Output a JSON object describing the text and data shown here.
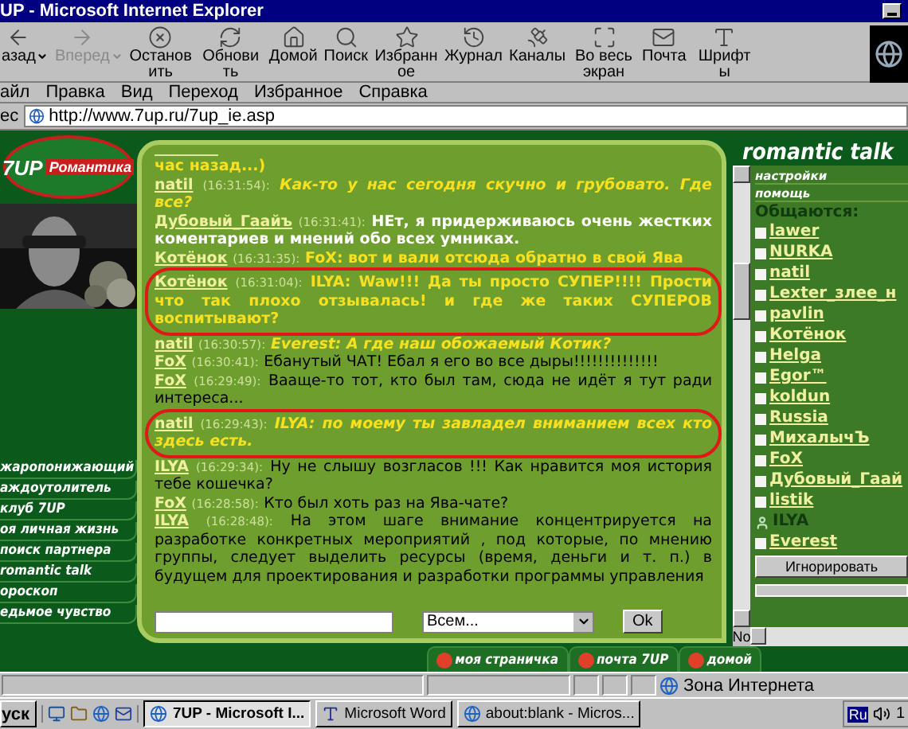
{
  "window": {
    "title": "UP - Microsoft Internet Explorer"
  },
  "toolbar": [
    {
      "label": "азад",
      "disabled": false,
      "dropdown": true
    },
    {
      "label": "Вперед",
      "disabled": true,
      "dropdown": true
    },
    {
      "label": "Остановить",
      "disabled": false,
      "dropdown": false
    },
    {
      "label": "Обновить",
      "disabled": false,
      "dropdown": false
    },
    {
      "label": "Домой",
      "disabled": false,
      "dropdown": false
    },
    {
      "label": "Поиск",
      "disabled": false,
      "dropdown": false
    },
    {
      "label": "Избранное",
      "disabled": false,
      "dropdown": false
    },
    {
      "label": "Журнал",
      "disabled": false,
      "dropdown": false
    },
    {
      "label": "Каналы",
      "disabled": false,
      "dropdown": false
    },
    {
      "label": "Во весь экран",
      "disabled": false,
      "dropdown": false
    },
    {
      "label": "Почта",
      "disabled": false,
      "dropdown": false
    },
    {
      "label": "Шрифты",
      "disabled": false,
      "dropdown": false
    }
  ],
  "menu": [
    "айл",
    "Правка",
    "Вид",
    "Переход",
    "Избранное",
    "Справка"
  ],
  "address": {
    "label": "ес",
    "value": "http://www.7up.ru/7up_ie.asp"
  },
  "logo": {
    "brand": "7UP",
    "tagline": "Романтика"
  },
  "nav": [
    "жаропонижающий",
    "аждоутолитель",
    "клуб 7UP",
    "оя личная жизнь",
    "поиск партнера",
    "romantic talk",
    "ороскоп",
    "едьмое чувство"
  ],
  "chat": [
    {
      "text": "час назад...)",
      "kind": "yellow-bold",
      "circled": false
    },
    {
      "nick": "natil",
      "time": "(16:31:54):",
      "text": "Как-то у нас сегодня скучно и грубовато. Где все?",
      "kind": "yellow-italic",
      "circled": false
    },
    {
      "nick": "Дубовый_Гаайъ",
      "time": "(16:31:41):",
      "text": "НЕт, я придерживаюсь очень жестких коментариев и мнений обо всех умниках.",
      "kind": "white-bold",
      "circled": false
    },
    {
      "nick": "Котёнок",
      "time": "(16:31:35):",
      "text": "FoX: вот и вали отсюда обратно в свой Ява",
      "kind": "yellow-bold",
      "circled": false
    },
    {
      "nick": "Котёнок",
      "time": "(16:31:04):",
      "text": "ILYA: Waw!!! Да ты просто СУПЕР!!!! Прости что так плохо отзывалась! и где же таких СУПЕРОВ воспитывают?",
      "kind": "yellow-bold",
      "circled": true
    },
    {
      "nick": "natil",
      "time": "(16:30:57):",
      "text": "Everest: А где наш обожаемый Котик?",
      "kind": "yellow-italic",
      "circled": false
    },
    {
      "nick": "FoX",
      "time": "(16:30:41):",
      "text": "Ебанутый ЧАТ! Ебал я его во все дыры!!!!!!!!!!!!!!",
      "kind": "plain",
      "circled": false
    },
    {
      "nick": "FoX",
      "time": "(16:29:49):",
      "text": "Вааще-то тот, кто был там, сюда не идёт я тут ради интереса...",
      "kind": "plain",
      "circled": false
    },
    {
      "nick": "natil",
      "time": "(16:29:43):",
      "text": "ILYA: по моему ты завладел вниманием всех кто здесь есть.",
      "kind": "yellow-italic",
      "circled": true
    },
    {
      "nick": "ILYA",
      "time": "(16:29:34):",
      "text": "Ну не слышу возгласов !!! Как нравится моя история тебе кошечка?",
      "kind": "plain",
      "circled": false
    },
    {
      "nick": "FoX",
      "time": "(16:28:58):",
      "text": "Кто был хоть раз на Ява-чате?",
      "kind": "plain",
      "circled": false
    },
    {
      "nick": "ILYA",
      "time": "(16:28:48):",
      "text": "На этом шаге внимание концентрируется на разработке конкретных мероприятий , под которые, по мнению группы, следует выделить ресурсы (время, деньги и т. п.) в будущем для проектирования и разработки программы управления",
      "kind": "plain",
      "circled": false
    }
  ],
  "input": {
    "recipient": "Всем...",
    "ok": "Ok",
    "no": "No"
  },
  "side": {
    "title": "romantic talk",
    "links": [
      "настройки",
      "помощь"
    ],
    "heading": "Общаются:",
    "ignore": "Игнорировать",
    "users": [
      {
        "name": "lawer",
        "kind": "user",
        "checked": false
      },
      {
        "name": "NURKA",
        "kind": "user",
        "checked": false
      },
      {
        "name": "natil",
        "kind": "user",
        "checked": false
      },
      {
        "name": "Lexter_злее_н",
        "kind": "user",
        "checked": false
      },
      {
        "name": "pavlin",
        "kind": "user",
        "checked": false
      },
      {
        "name": "Котёнок",
        "kind": "user",
        "checked": false
      },
      {
        "name": "Helga",
        "kind": "user",
        "checked": false
      },
      {
        "name": "Egor™",
        "kind": "user",
        "checked": false
      },
      {
        "name": "koldun",
        "kind": "user",
        "checked": false
      },
      {
        "name": "Russia",
        "kind": "user",
        "checked": false
      },
      {
        "name": "МихалычЪ",
        "kind": "user",
        "checked": false
      },
      {
        "name": "FoX",
        "kind": "user",
        "checked": false
      },
      {
        "name": "Дубовый_Гаай",
        "kind": "user",
        "checked": false
      },
      {
        "name": "listik",
        "kind": "user",
        "checked": false
      },
      {
        "name": "ILYA",
        "kind": "self"
      },
      {
        "name": "Everest",
        "kind": "user",
        "checked": false
      }
    ]
  },
  "bottom_tabs": [
    "моя страничка",
    "почта 7UP",
    "домой"
  ],
  "status_bar": {
    "zone": "Зона Интернета"
  },
  "taskbar": {
    "start": "уск",
    "tasks": [
      {
        "label": "7UP - Microsoft I...",
        "kind": "browser",
        "selected": true
      },
      {
        "label": "Microsoft Word",
        "kind": "word",
        "selected": false
      },
      {
        "label": "about:blank - Micros...",
        "kind": "browser",
        "selected": false
      }
    ],
    "lang": "Ru",
    "clock": "1"
  }
}
